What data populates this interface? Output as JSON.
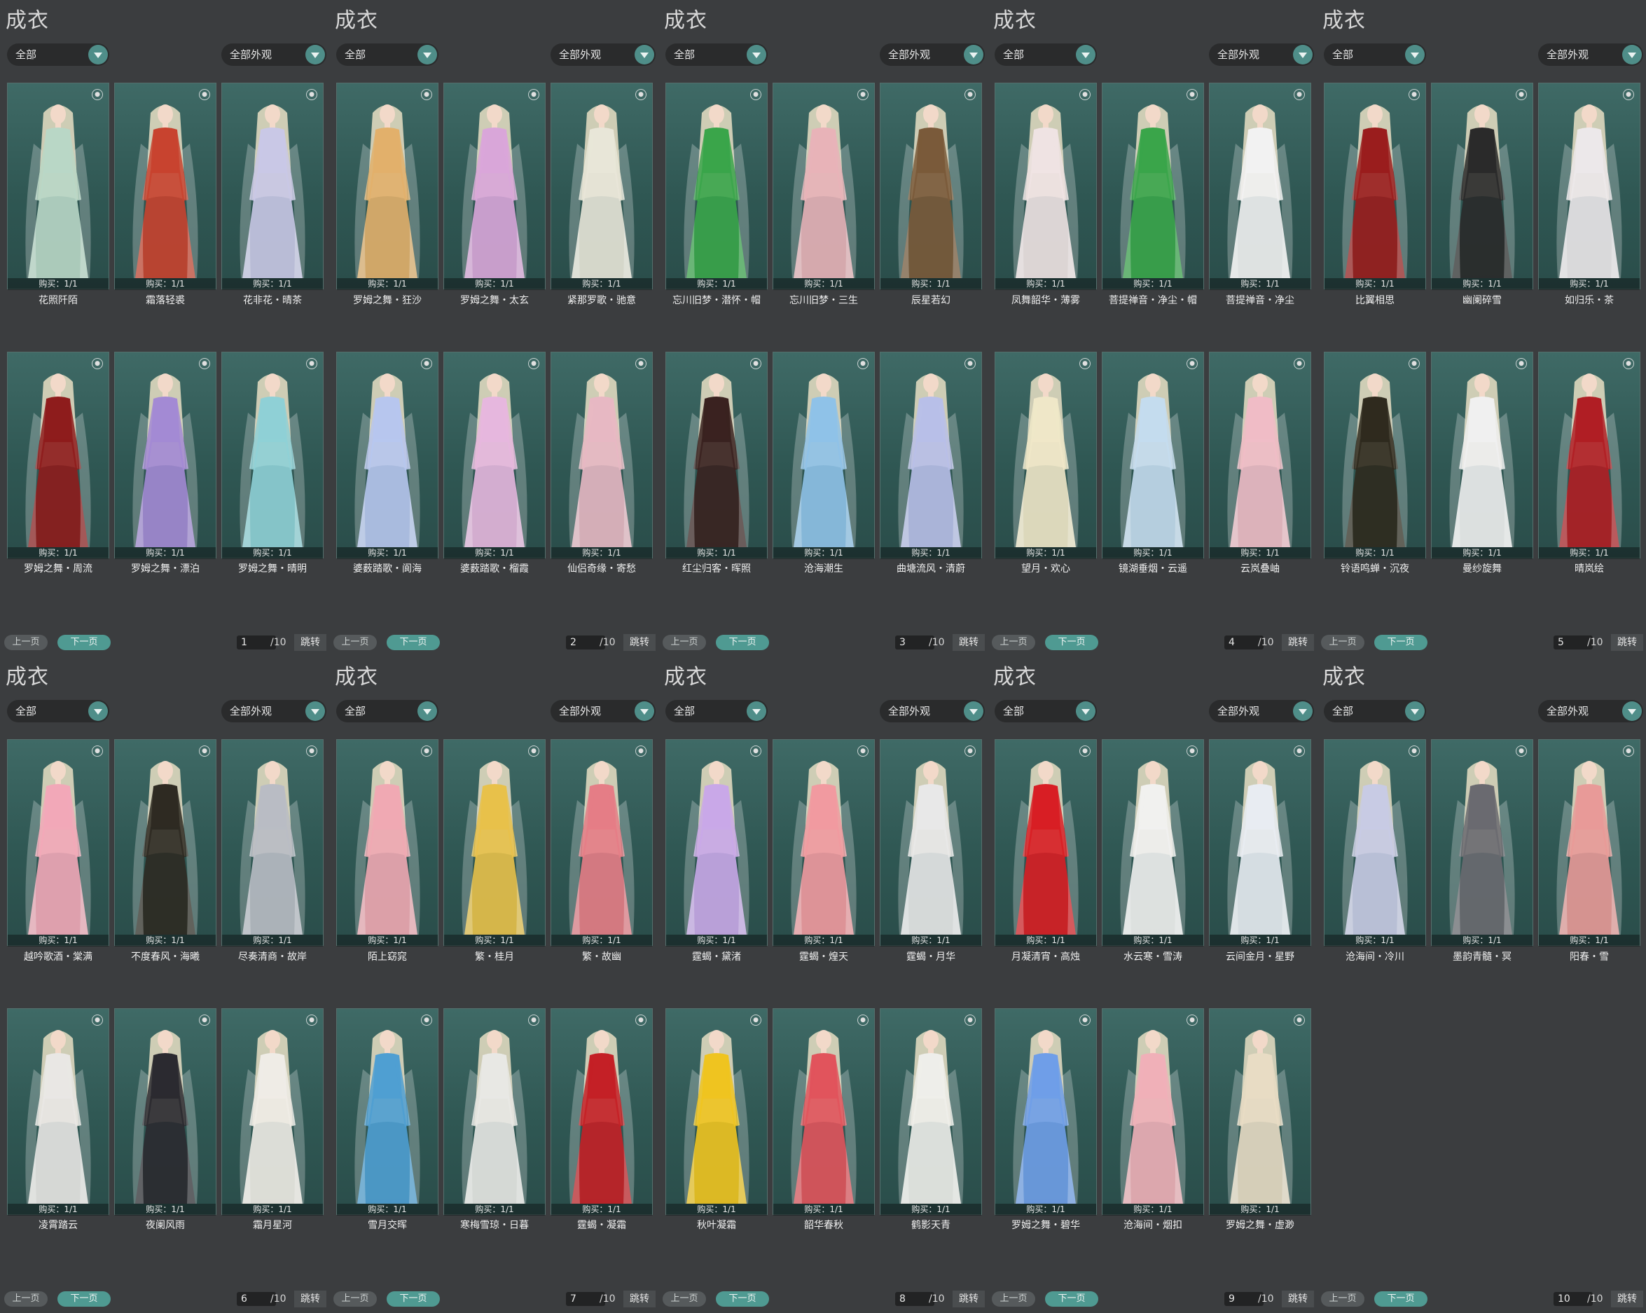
{
  "labels": {
    "title": "成衣",
    "filter_all": "全部",
    "filter_appearance": "全部外观",
    "prev": "上一页",
    "next": "下一页",
    "total": "/10",
    "jump": "跳转",
    "buy": "购买：1/1"
  },
  "colors": {
    "accent": "#4f9a92",
    "panel_bg": "#3b3d3f",
    "card_bg": "#2f5753"
  },
  "pages": [
    {
      "page": "1",
      "items": [
        {
          "name": "花照阡陌",
          "dress": "#b9d7c6"
        },
        {
          "name": "霜落轻裘",
          "dress": "#c8432f"
        },
        {
          "name": "花非花・晴茶",
          "dress": "#c9c8e6"
        },
        {
          "name": "罗姆之舞・周流",
          "dress": "#8e1c1c"
        },
        {
          "name": "罗姆之舞・漂泊",
          "dress": "#a38ad4"
        },
        {
          "name": "罗姆之舞・晴明",
          "dress": "#8fd0d6"
        }
      ]
    },
    {
      "page": "2",
      "items": [
        {
          "name": "罗姆之舞・狂沙",
          "dress": "#e2b06b"
        },
        {
          "name": "罗姆之舞・太玄",
          "dress": "#d9a6d9"
        },
        {
          "name": "紧那罗歌・驰意",
          "dress": "#e8e6d8"
        },
        {
          "name": "婆薮踏歌・阆海",
          "dress": "#b7c6ee"
        },
        {
          "name": "婆薮踏歌・榴霞",
          "dress": "#e6b7de"
        },
        {
          "name": "仙侣奇缘・寄愁",
          "dress": "#e7b8c3"
        }
      ]
    },
    {
      "page": "3",
      "items": [
        {
          "name": "忘川旧梦・潜怀・帽",
          "dress": "#3aa54a"
        },
        {
          "name": "忘川旧梦・三生",
          "dress": "#e8b3b8"
        },
        {
          "name": "辰星若幻",
          "dress": "#7a5a3a"
        },
        {
          "name": "红尘归客・晖照",
          "dress": "#3a2220"
        },
        {
          "name": "沧海潮生",
          "dress": "#8fc2e8"
        },
        {
          "name": "曲塘流风・清蔚",
          "dress": "#b8bfe8"
        }
      ]
    },
    {
      "page": "4",
      "items": [
        {
          "name": "凤舞韶华・薄雾",
          "dress": "#efe3e3"
        },
        {
          "name": "菩提禅音・净尘・帽",
          "dress": "#3aa54a"
        },
        {
          "name": "菩提禅音・净尘",
          "dress": "#f2f2f2"
        },
        {
          "name": "望月・欢心",
          "dress": "#efe7c8"
        },
        {
          "name": "镜湖垂烟・云遥",
          "dress": "#c4dcee"
        },
        {
          "name": "云岚叠岫",
          "dress": "#f0bcc6"
        }
      ]
    },
    {
      "page": "5",
      "items": [
        {
          "name": "比翼相思",
          "dress": "#9a1d1d"
        },
        {
          "name": "幽阑碎雪",
          "dress": "#2a2a2a"
        },
        {
          "name": "如归乐・茶",
          "dress": "#ece8ea"
        },
        {
          "name": "铃语鸣蝉・沉夜",
          "dress": "#2f2a1e"
        },
        {
          "name": "曼纱旋舞",
          "dress": "#f0f0f0"
        },
        {
          "name": "晴岚绘",
          "dress": "#b01e24"
        }
      ]
    },
    {
      "page": "6",
      "items": [
        {
          "name": "越吟歌酒・棠满",
          "dress": "#f2a8b8"
        },
        {
          "name": "不度春风・海曦",
          "dress": "#2e2a22"
        },
        {
          "name": "尽奏清商・故岸",
          "dress": "#b9bcc4"
        },
        {
          "name": "凌霄踏云",
          "dress": "#e9e7e4"
        },
        {
          "name": "夜阑风雨",
          "dress": "#2b2a30"
        },
        {
          "name": "霜月星河",
          "dress": "#efece6"
        }
      ]
    },
    {
      "page": "7",
      "items": [
        {
          "name": "陌上窈窕",
          "dress": "#f0a9b3"
        },
        {
          "name": "繁・桂月",
          "dress": "#e8c14a"
        },
        {
          "name": "繁・故幽",
          "dress": "#e57d86"
        },
        {
          "name": "雪月交晖",
          "dress": "#4f9fd2"
        },
        {
          "name": "寒梅雪琼・日暮",
          "dress": "#e8e8e4"
        },
        {
          "name": "霆蝎・凝霜",
          "dress": "#c42026"
        }
      ]
    },
    {
      "page": "8",
      "items": [
        {
          "name": "霆蝎・黛渚",
          "dress": "#c9a8e8"
        },
        {
          "name": "霆蝎・煌天",
          "dress": "#f19aa0"
        },
        {
          "name": "霆蝎・月华",
          "dress": "#e8e8e8"
        },
        {
          "name": "秋叶凝霜",
          "dress": "#efc420"
        },
        {
          "name": "韶华春秋",
          "dress": "#e1545c"
        },
        {
          "name": "鹤影天青",
          "dress": "#eeeeea"
        }
      ]
    },
    {
      "page": "9",
      "items": [
        {
          "name": "月凝清宵・高烛",
          "dress": "#d81e24"
        },
        {
          "name": "水云寒・雪涛",
          "dress": "#f1f1ef"
        },
        {
          "name": "云间金月・星野",
          "dress": "#e8ecf2"
        },
        {
          "name": "罗姆之舞・碧华",
          "dress": "#6f9ee8"
        },
        {
          "name": "沧海间・烟扣",
          "dress": "#f0b0b8"
        },
        {
          "name": "罗姆之舞・虚渺",
          "dress": "#e8dcc4"
        }
      ]
    },
    {
      "page": "10",
      "items": [
        {
          "name": "沧海间・冷川",
          "dress": "#c8cbe4"
        },
        {
          "name": "墨韵青髓・冥",
          "dress": "#6a6a70"
        },
        {
          "name": "阳春・雪",
          "dress": "#e89a98"
        }
      ]
    }
  ]
}
